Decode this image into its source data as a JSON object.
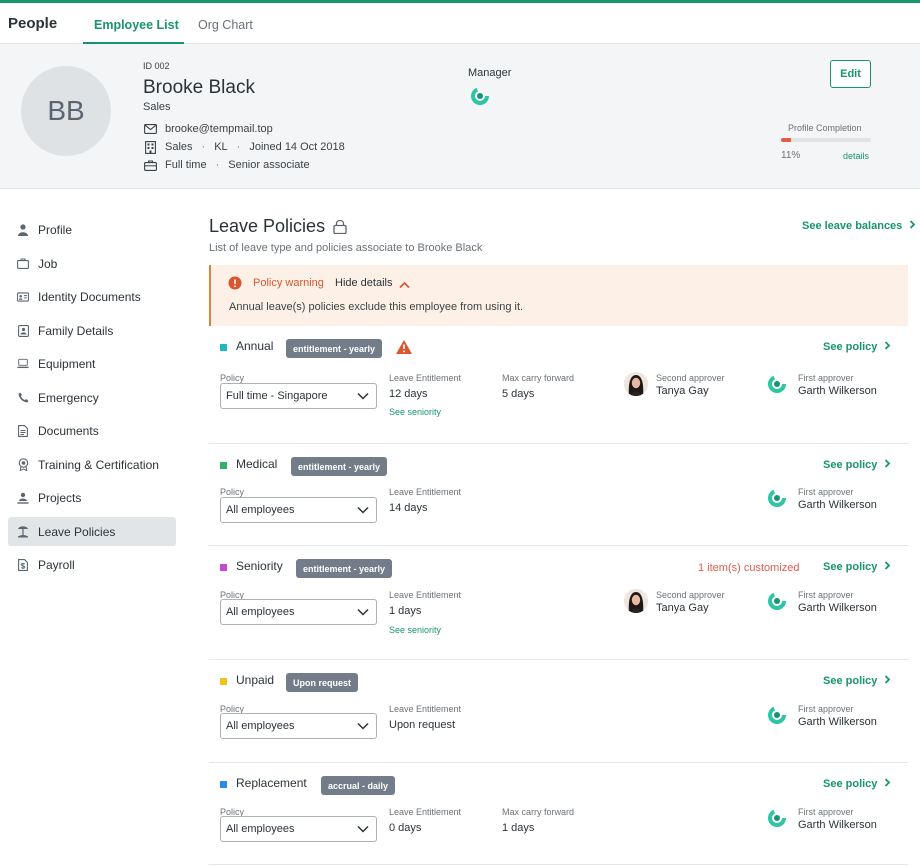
{
  "app": {
    "title": "People",
    "tabs": [
      {
        "label": "Employee List",
        "active": true
      },
      {
        "label": "Org Chart",
        "active": false
      }
    ]
  },
  "profile": {
    "initials": "BB",
    "id_label": "ID 002",
    "name": "Brooke Black",
    "department": "Sales",
    "email": "brooke@tempmail.top",
    "office_dept": "Sales",
    "location": "KL",
    "joined": "Joined 14 Oct 2018",
    "employment_type": "Full time",
    "position": "Senior associate",
    "manager_label": "Manager",
    "edit_label": "Edit",
    "completion_label": "Profile Completion",
    "completion_percent": 11,
    "completion_text": "11%",
    "completion_details": "details"
  },
  "sidebar": {
    "items": [
      {
        "label": "Profile",
        "icon": "person-icon",
        "active": false
      },
      {
        "label": "Job",
        "icon": "briefcase-icon",
        "active": false
      },
      {
        "label": "Identity Documents",
        "icon": "id-card-icon",
        "active": false
      },
      {
        "label": "Family Details",
        "icon": "family-icon",
        "active": false
      },
      {
        "label": "Equipment",
        "icon": "laptop-icon",
        "active": false
      },
      {
        "label": "Emergency",
        "icon": "phone-icon",
        "active": false
      },
      {
        "label": "Documents",
        "icon": "document-icon",
        "active": false
      },
      {
        "label": "Training & Certification",
        "icon": "award-icon",
        "active": false
      },
      {
        "label": "Projects",
        "icon": "project-icon",
        "active": false
      },
      {
        "label": "Leave Policies",
        "icon": "beach-icon",
        "active": true
      },
      {
        "label": "Payroll",
        "icon": "payroll-icon",
        "active": false
      }
    ]
  },
  "main": {
    "title": "Leave Policies",
    "subtitle": "List of leave type and policies associate to Brooke Black",
    "see_balances": "See leave balances",
    "warning": {
      "title": "Policy warning",
      "toggle": "Hide details",
      "message": "Annual leave(s) policies exclude this employee from using it."
    }
  },
  "labels": {
    "policy": "Policy",
    "leave_entitlement": "Leave Entitlement",
    "max_carry_forward": "Max carry forward",
    "second_approver": "Second approver",
    "first_approver": "First approver",
    "see_policy": "See policy",
    "see_seniority": "See seniority"
  },
  "policies": [
    {
      "name": "Annual",
      "color": "#1ab9c4",
      "badge": "entitlement - yearly",
      "has_warning": true,
      "policy": "Full time - Singapore",
      "entitlement": "12 days",
      "carry_forward": "5 days",
      "second_approver": "Tanya Gay",
      "first_approver": "Garth Wilkerson"
    },
    {
      "name": "Medical",
      "color": "#2fb36a",
      "badge": "entitlement - yearly",
      "policy": "All employees",
      "entitlement": "14 days",
      "first_approver": "Garth Wilkerson"
    },
    {
      "name": "Seniority",
      "color": "#c44ad6",
      "badge": "entitlement - yearly",
      "customized": "1 item(s) customized",
      "policy": "All employees",
      "entitlement": "1 days",
      "second_approver": "Tanya Gay",
      "first_approver": "Garth Wilkerson"
    },
    {
      "name": "Unpaid",
      "color": "#f1c21b",
      "badge": "Upon request",
      "policy": "All employees",
      "entitlement": "Upon request",
      "first_approver": "Garth Wilkerson"
    },
    {
      "name": "Replacement",
      "color": "#2b8ce6",
      "badge": "accrual - daily",
      "policy": "All employees",
      "entitlement": "0 days",
      "carry_forward": "1 days",
      "first_approver": "Garth Wilkerson"
    }
  ],
  "colors": {
    "brand": "#17956f",
    "warning": "#d9562f",
    "danger": "#e65a4b",
    "badge": "#727d89"
  }
}
